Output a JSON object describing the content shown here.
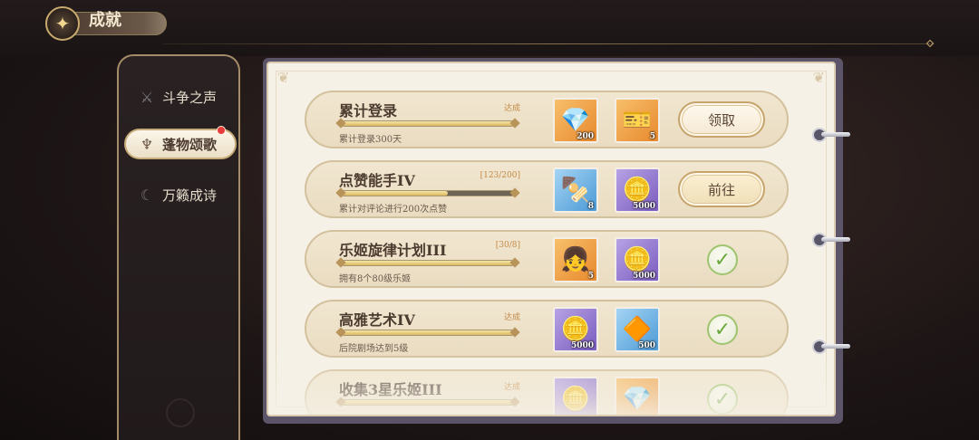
{
  "header": {
    "title": "成就",
    "emblem_icon": "compass-emblem-icon"
  },
  "nav": {
    "items": [
      {
        "label": "斗争之声",
        "icon": "swords-icon",
        "active": false
      },
      {
        "label": "蓬物颂歌",
        "icon": "harp-icon",
        "active": true,
        "badge": true
      },
      {
        "label": "万籁成诗",
        "icon": "moon-icon",
        "active": false
      }
    ]
  },
  "achievements": [
    {
      "name": "累计登录",
      "progress_text": "达成",
      "progress": 1.0,
      "desc": "累计登录300天",
      "rewards": [
        {
          "icon": "crystal-icon",
          "glyph": "💎",
          "qty": "200",
          "color": "orange"
        },
        {
          "icon": "ticket-icon",
          "glyph": "🎫",
          "qty": "5",
          "color": "orange"
        }
      ],
      "action": {
        "type": "claim",
        "label": "领取"
      }
    },
    {
      "name": "点赞能手IV",
      "progress_text": "[123/200]",
      "progress": 0.615,
      "desc": "累计对评论进行200次点赞",
      "rewards": [
        {
          "icon": "skewer-icon",
          "glyph": "🍢",
          "qty": "8",
          "color": "blue"
        },
        {
          "icon": "gold-coin-icon",
          "glyph": "🪙",
          "qty": "5000",
          "color": "purple"
        }
      ],
      "action": {
        "type": "goto",
        "label": "前往"
      }
    },
    {
      "name": "乐姬旋律计划III",
      "progress_text": "[30/8]",
      "progress": 1.0,
      "desc": "拥有8个80级乐姬",
      "rewards": [
        {
          "icon": "character-portrait-icon",
          "glyph": "👧",
          "qty": "5",
          "color": "orange"
        },
        {
          "icon": "gold-coin-icon",
          "glyph": "🪙",
          "qty": "5000",
          "color": "purple"
        }
      ],
      "action": {
        "type": "done"
      }
    },
    {
      "name": "高雅艺术IV",
      "progress_text": "达成",
      "progress": 1.0,
      "desc": "后院剧场达到5级",
      "rewards": [
        {
          "icon": "gold-coin-icon",
          "glyph": "🪙",
          "qty": "5000",
          "color": "purple"
        },
        {
          "icon": "amber-drop-icon",
          "glyph": "🔶",
          "qty": "500",
          "color": "blue"
        }
      ],
      "action": {
        "type": "done"
      }
    },
    {
      "name": "收集3星乐姬III",
      "progress_text": "达成",
      "progress": 1.0,
      "desc": "",
      "rewards": [
        {
          "icon": "gold-coin-icon",
          "glyph": "🪙",
          "qty": "",
          "color": "purple"
        },
        {
          "icon": "crystal-icon",
          "glyph": "💎",
          "qty": "",
          "color": "orange"
        }
      ],
      "action": {
        "type": "done"
      }
    }
  ],
  "done_glyph": "✓"
}
